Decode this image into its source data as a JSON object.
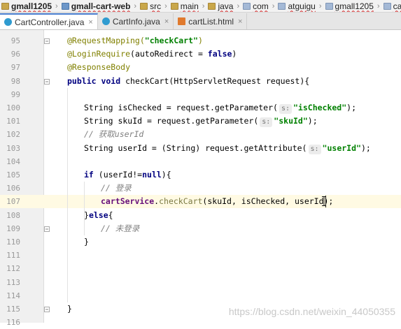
{
  "breadcrumb": [
    {
      "label": "gmall1205",
      "icon": "folder-icon",
      "bold": true
    },
    {
      "label": "gmall-cart-web",
      "icon": "module-icon",
      "bold": true
    },
    {
      "label": "src",
      "icon": "folder-icon"
    },
    {
      "label": "main",
      "icon": "folder-icon"
    },
    {
      "label": "java",
      "icon": "folder-icon"
    },
    {
      "label": "com",
      "icon": "package-icon"
    },
    {
      "label": "atguigu",
      "icon": "package-icon"
    },
    {
      "label": "gmall1205",
      "icon": "package-icon"
    },
    {
      "label": "cart",
      "icon": "package-icon"
    }
  ],
  "tabs": [
    {
      "label": "CartController.java",
      "icon": "C",
      "active": true
    },
    {
      "label": "CartInfo.java",
      "icon": "C",
      "active": false
    },
    {
      "label": "cartList.html",
      "icon": "H",
      "active": false
    }
  ],
  "editor": {
    "current_line": 107,
    "lines": [
      {
        "n": "95",
        "tokens": [
          [
            "ann",
            "@RequestMapping("
          ],
          [
            "str",
            "\"checkCart\""
          ],
          [
            "ann",
            ")"
          ]
        ],
        "indent": 1
      },
      {
        "n": "96",
        "tokens": [
          [
            "ann",
            "@LoginRequire"
          ],
          [
            "",
            "(autoRedirect = "
          ],
          [
            "kw",
            "false"
          ],
          [
            "",
            ")"
          ]
        ],
        "indent": 1
      },
      {
        "n": "97",
        "tokens": [
          [
            "ann",
            "@ResponseBody"
          ]
        ],
        "indent": 1
      },
      {
        "n": "98",
        "tokens": [
          [
            "kw",
            "public void "
          ],
          [
            "",
            "checkCart(HttpServletRequest request){"
          ]
        ],
        "indent": 1
      },
      {
        "n": "99",
        "tokens": [],
        "indent": 0
      },
      {
        "n": "100",
        "tokens": [
          [
            "",
            "String isChecked = request.getParameter("
          ],
          [
            "hint",
            "s:"
          ],
          [
            "str",
            "\"isChecked\""
          ],
          [
            "",
            ");"
          ]
        ],
        "indent": 2
      },
      {
        "n": "101",
        "tokens": [
          [
            "",
            "String skuId = request.getParameter("
          ],
          [
            "hint",
            "s:"
          ],
          [
            "str",
            "\"skuId\""
          ],
          [
            "",
            ");"
          ]
        ],
        "indent": 2
      },
      {
        "n": "102",
        "tokens": [
          [
            "cmt",
            "// 获取userId"
          ]
        ],
        "indent": 2
      },
      {
        "n": "103",
        "tokens": [
          [
            "",
            "String userId = (String) request.getAttribute("
          ],
          [
            "hint",
            "s:"
          ],
          [
            "str",
            "\"userId\""
          ],
          [
            "",
            ");"
          ]
        ],
        "indent": 2
      },
      {
        "n": "104",
        "tokens": [],
        "indent": 0
      },
      {
        "n": "105",
        "tokens": [
          [
            "kw",
            "if "
          ],
          [
            "",
            "(userId!="
          ],
          [
            "kw",
            "null"
          ],
          [
            "",
            "){"
          ]
        ],
        "indent": 2
      },
      {
        "n": "106",
        "tokens": [
          [
            "cmt",
            "// 登录"
          ]
        ],
        "indent": 3
      },
      {
        "n": "107",
        "tokens": [
          [
            "fld",
            "cartService"
          ],
          [
            "",
            "."
          ],
          [
            "mth",
            "checkCart"
          ],
          [
            "",
            "(skuId, isChecked, userId);"
          ]
        ],
        "indent": 3
      },
      {
        "n": "108",
        "tokens": [
          [
            "",
            "}"
          ],
          [
            "kw",
            "else"
          ],
          [
            "",
            "{"
          ]
        ],
        "indent": 2
      },
      {
        "n": "109",
        "tokens": [
          [
            "cmt",
            "// 未登录"
          ]
        ],
        "indent": 3
      },
      {
        "n": "110",
        "tokens": [
          [
            "",
            "}"
          ]
        ],
        "indent": 2
      },
      {
        "n": "111",
        "tokens": [],
        "indent": 0
      },
      {
        "n": "112",
        "tokens": [],
        "indent": 0
      },
      {
        "n": "113",
        "tokens": [],
        "indent": 0
      },
      {
        "n": "114",
        "tokens": [],
        "indent": 0
      },
      {
        "n": "115",
        "tokens": [
          [
            "",
            "}"
          ]
        ],
        "indent": 1
      },
      {
        "n": "116",
        "tokens": [],
        "indent": 0
      }
    ]
  },
  "watermark": "https://blog.csdn.net/weixin_44050355"
}
